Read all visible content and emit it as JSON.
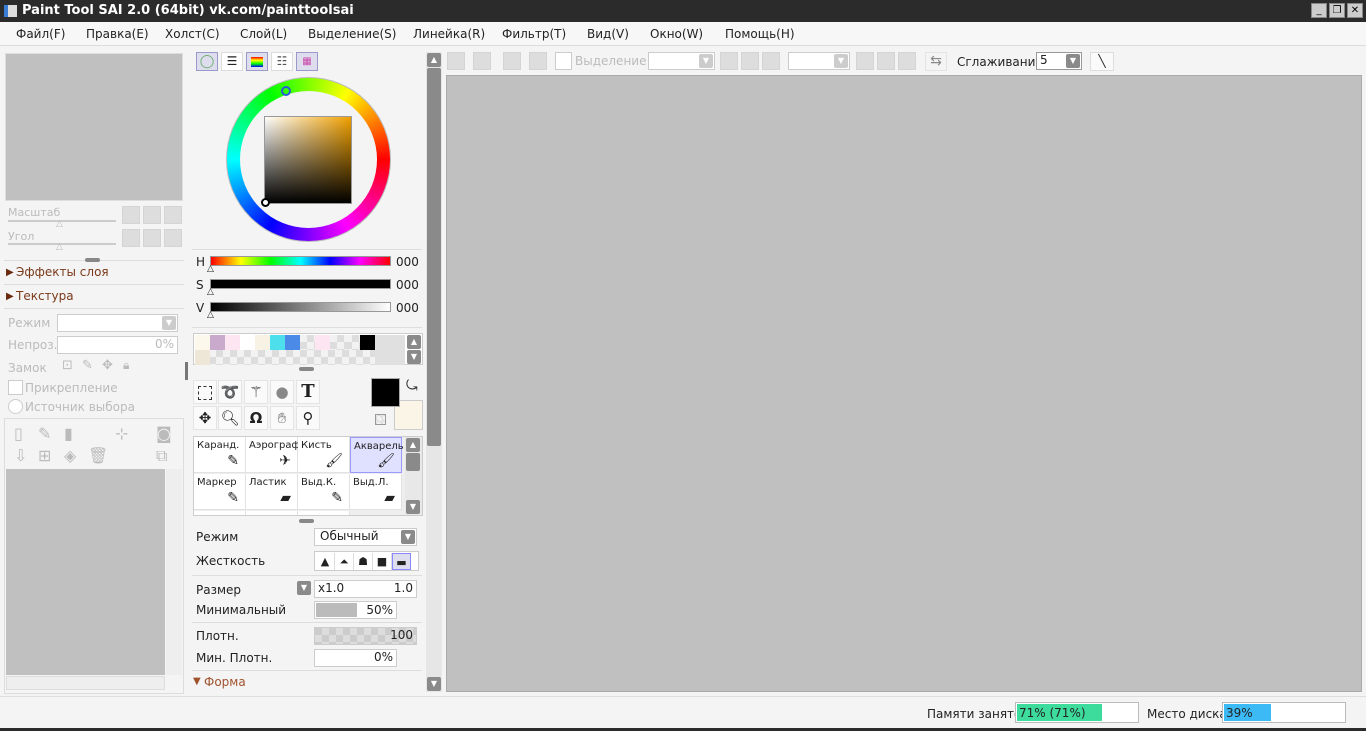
{
  "title": "Paint Tool SAI 2.0 (64bit) vk.com/painttoolsai",
  "window_controls": [
    "_",
    "❐",
    "✕"
  ],
  "menu": [
    "Файл(F)",
    "Правка(E)",
    "Холст(C)",
    "Слой(L)",
    "Выделение(S)",
    "Линейка(R)",
    "Фильтр(T)",
    "Вид(V)",
    "Окно(W)",
    "Помощь(H)"
  ],
  "navigator": {
    "scale_label": "Масштаб",
    "angle_label": "Угол"
  },
  "layer_panel": {
    "effects": "Эффекты слоя",
    "texture": "Текстура",
    "mode_label": "Режим",
    "mode_value": "",
    "opacity_label": "Непроз.",
    "opacity_value": "0%",
    "lock_label": "Замок",
    "clip_label": "Прикрепление",
    "source_label": "Источник выбора"
  },
  "color": {
    "h_label": "H",
    "s_label": "S",
    "v_label": "V",
    "h_value": "000",
    "s_value": "000",
    "v_value": "000",
    "fg": "#000000",
    "bg": "#faf5e6",
    "swatches": [
      "#fdf8ec",
      "#c9a9cc",
      "#fde6f2",
      "#ffffff",
      "#f8f2e4",
      "#4ddfeb",
      "#4c8ae8",
      "chk",
      "#fde6f2",
      "chk",
      "chk",
      "#000000"
    ]
  },
  "brushes": [
    {
      "name": "Каранд.",
      "icon": "✎"
    },
    {
      "name": "Аэрограф",
      "icon": "✈"
    },
    {
      "name": "Кисть",
      "icon": "🖌"
    },
    {
      "name": "Акварель",
      "icon": "🖌",
      "selected": true
    },
    {
      "name": "Маркер",
      "icon": "✎"
    },
    {
      "name": "Ластик",
      "icon": "▰"
    },
    {
      "name": "Выд.К.",
      "icon": "✎"
    },
    {
      "name": "Выд.Л.",
      "icon": "▰"
    }
  ],
  "brush_settings": {
    "mode_label": "Режим",
    "mode_value": "Обычный",
    "hardness_label": "Жесткость",
    "size_label": "Размер",
    "size_mult": "x1.0",
    "size_value": "1.0",
    "min_label": "Минимальный",
    "min_value": "50%",
    "min_fraction": 0.5,
    "density_label": "Плотн.",
    "density_value": "100",
    "min_density_label": "Мин. Плотн.",
    "min_density_value": "0%",
    "shape_label": "Форма"
  },
  "toolbar": {
    "selection_label": "Выделение",
    "smoothing_label": "Сглаживание",
    "smoothing_value": "5"
  },
  "status": {
    "memory_label": "Памяти занято",
    "memory_value": "71% (71%)",
    "memory_fraction": 0.71,
    "memory_color": "#3ddc9c",
    "disk_label": "Место диска",
    "disk_value": "39%",
    "disk_fraction": 0.39,
    "disk_color": "#3cbaf5"
  }
}
